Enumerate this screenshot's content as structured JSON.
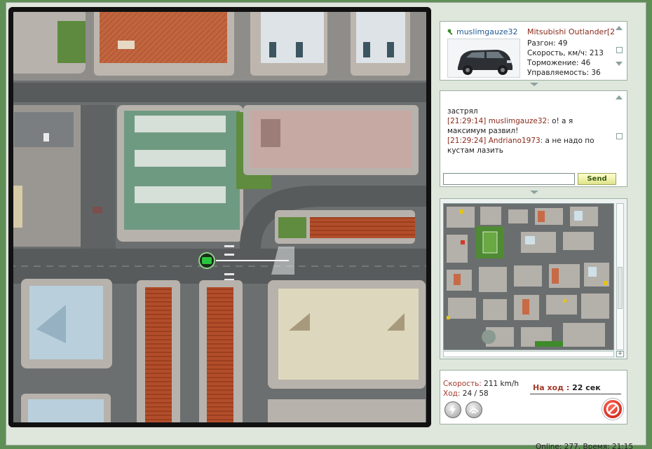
{
  "player": {
    "name": "muslimgauze32",
    "car_model": "Mitsubishi Outlander[2",
    "stats": [
      {
        "label": "Разгон:",
        "value": "49"
      },
      {
        "label": "Скорость, км/ч:",
        "value": "213"
      },
      {
        "label": "Торможение:",
        "value": "46"
      },
      {
        "label": "Управляемость:",
        "value": "36"
      }
    ]
  },
  "chat": {
    "messages": [
      {
        "time": "",
        "user": "",
        "text": "застрял"
      },
      {
        "time": "[21:29:14]",
        "user": "muslimgauze32:",
        "text": " о! а я максимум развил!"
      },
      {
        "time": "[21:29:24]",
        "user": "Andriano1973:",
        "text": " а не надо по кустам лазить"
      }
    ],
    "input_value": "",
    "send_label": "Send"
  },
  "status": {
    "speed_label": "Скорость:",
    "speed_value": "211 km/h",
    "move_label": "Ход:",
    "move_value": "24 / 58",
    "turn_label": "На ход :",
    "turn_value": "22 сек"
  },
  "footer": "Online: 277, Время: 21:15",
  "colors": {
    "accent_red": "#a23a2a",
    "player_blue": "#1f5a93",
    "send_green": "#dfe48a",
    "background": "#5f8f57"
  },
  "icons": {
    "key": "key-icon",
    "nitro": "lightning-icon",
    "signal": "wave-icon",
    "stop": "stop-icon"
  }
}
